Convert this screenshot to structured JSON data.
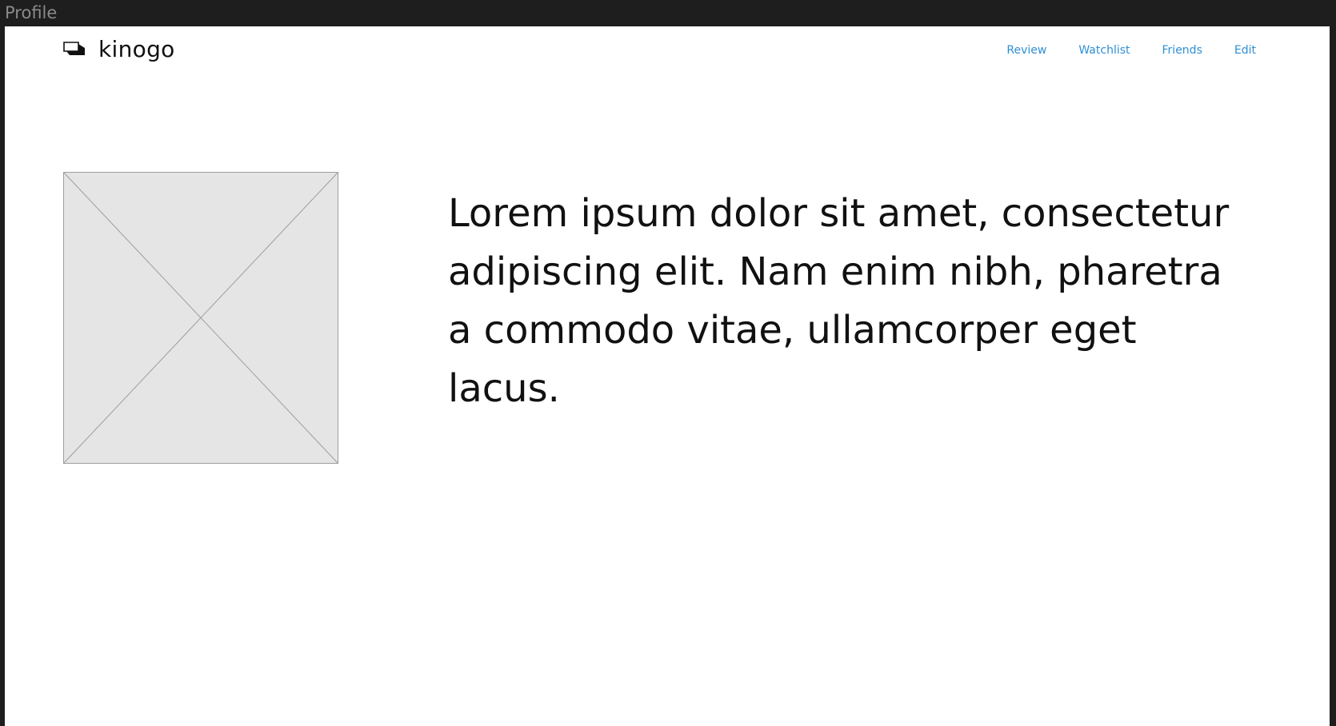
{
  "frame": {
    "title": "Profile"
  },
  "header": {
    "brand": "kinogo",
    "nav": [
      {
        "label": "Review"
      },
      {
        "label": "Watchlist"
      },
      {
        "label": "Friends"
      },
      {
        "label": "Edit"
      }
    ]
  },
  "main": {
    "image_placeholder_icon": "image-placeholder-icon",
    "intro_text": "Lorem ipsum dolor sit amet, consectetur adipiscing elit. Nam enim nibh, pharetra a commodo vitae, ullamcorper eget lacus."
  },
  "colors": {
    "background_outer": "#1e1e1e",
    "frame_title": "#8a8a8a",
    "page_bg": "#ffffff",
    "nav_link": "#2f8fd5",
    "text": "#111111",
    "placeholder_fill": "#e5e5e5",
    "placeholder_stroke": "#9e9e9e"
  }
}
